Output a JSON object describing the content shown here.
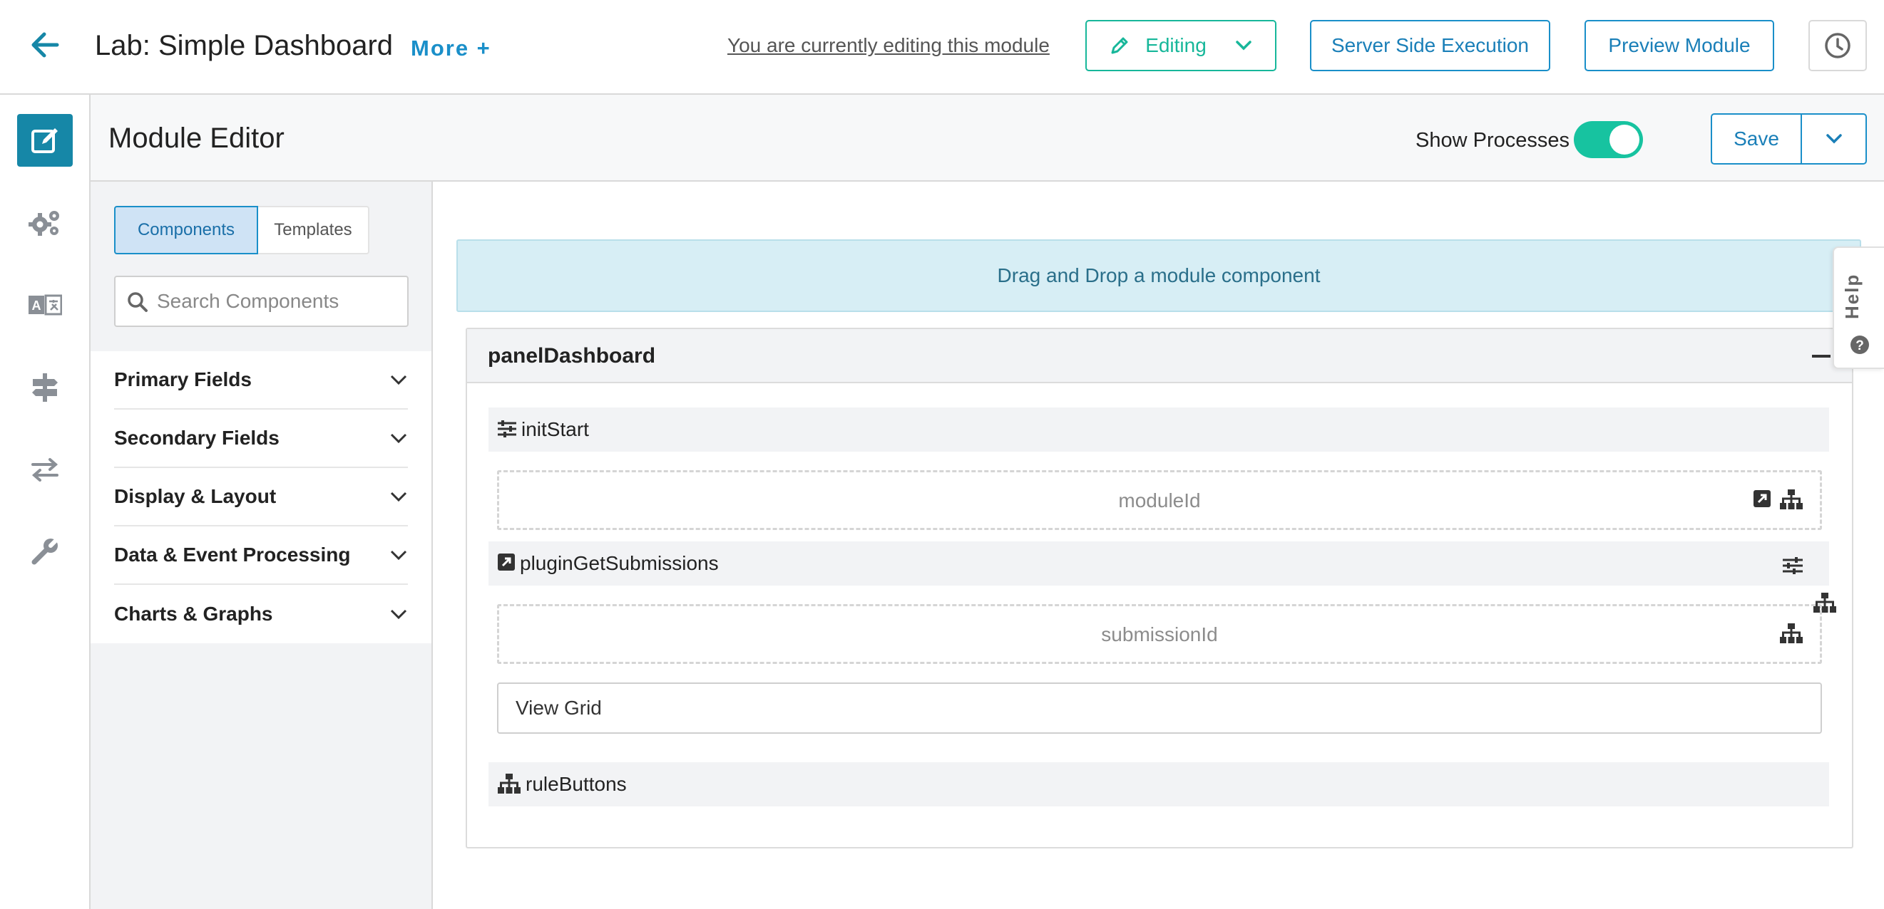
{
  "header": {
    "title": "Lab: Simple Dashboard",
    "more_label": "More +",
    "editing_notice": "You are currently editing this module",
    "editing_label": "Editing",
    "server_label": "Server Side Execution",
    "preview_label": "Preview Module"
  },
  "editor": {
    "title": "Module Editor",
    "show_processes_label": "Show Processes",
    "show_processes_on": true,
    "save_label": "Save"
  },
  "components_panel": {
    "tabs": [
      {
        "label": "Components",
        "active": true
      },
      {
        "label": "Templates",
        "active": false
      }
    ],
    "search_placeholder": "Search Components",
    "sections": [
      {
        "label": "Primary Fields"
      },
      {
        "label": "Secondary Fields"
      },
      {
        "label": "Display & Layout"
      },
      {
        "label": "Data & Event Processing"
      },
      {
        "label": "Charts & Graphs"
      }
    ]
  },
  "canvas": {
    "drop_hint": "Drag and Drop a module component",
    "panel_title": "panelDashboard",
    "rows": {
      "init_start": "initStart",
      "module_id": "moduleId",
      "plugin": "pluginGetSubmissions",
      "submission_id": "submissionId",
      "view_grid": "View Grid",
      "rule_buttons": "ruleButtons"
    }
  },
  "help": {
    "label": "Help"
  },
  "colors": {
    "accent": "#1a8fc9",
    "success": "#17b79a",
    "rail_active": "#1687a7",
    "banner": "#d7eef5"
  },
  "icons": [
    "back-arrow-icon",
    "pencil-icon",
    "chevron-down-icon",
    "clock-icon",
    "edit-icon",
    "gears-icon",
    "translate-icon",
    "signpost-icon",
    "transfer-icon",
    "wrench-icon",
    "search-icon",
    "sliders-icon",
    "external-link-icon",
    "hierarchy-icon",
    "help-icon"
  ]
}
